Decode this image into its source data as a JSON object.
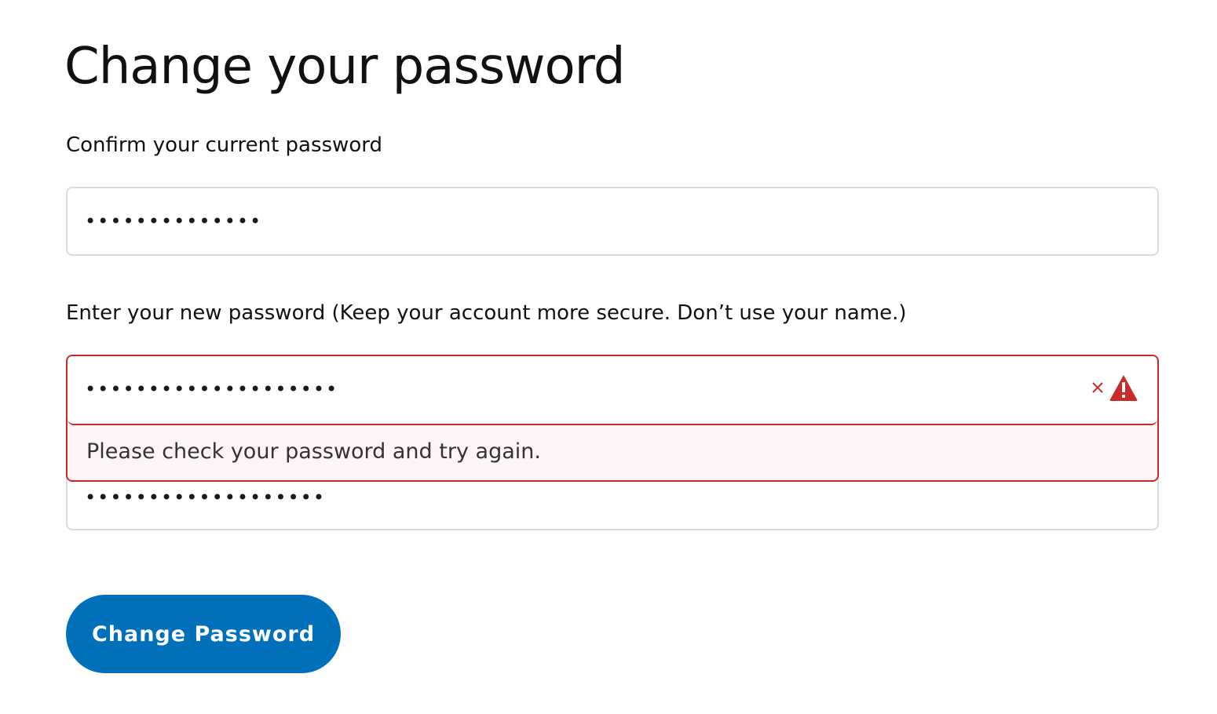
{
  "page": {
    "title": "Change your password"
  },
  "form": {
    "current_password": {
      "label": "Confirm your current password",
      "value": "qwertyuiop1234"
    },
    "new_password": {
      "label": "Enter your new password (Keep your account more secure. Don’t use your name.)",
      "value": "newpassword123456789",
      "error_message": "Please check your password and try again.",
      "clear_icon": "close-icon",
      "warning_icon": "warning-triangle-icon"
    },
    "confirm_password": {
      "value": "newpassword12345678"
    },
    "submit_label": "Change Password"
  },
  "colors": {
    "primary": "#0070ba",
    "error": "#c92a2a",
    "error_background": "#fdf4f5",
    "input_border": "#d4dde6"
  }
}
